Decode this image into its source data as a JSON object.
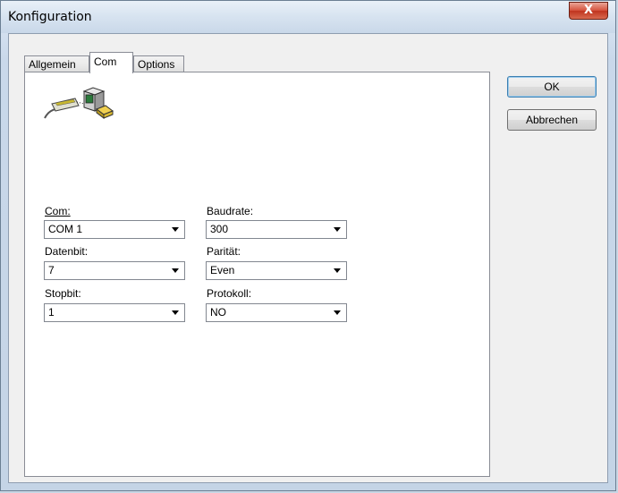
{
  "window": {
    "title": "Konfiguration",
    "close_glyph": "X"
  },
  "tabs": [
    {
      "label": "Allgemein",
      "active": false
    },
    {
      "label": "Com",
      "active": true
    },
    {
      "label": "Options",
      "active": false
    }
  ],
  "icon": "serial-port-computer-icon",
  "fields": {
    "com": {
      "label": "Com:",
      "value": "COM 1"
    },
    "baudrate": {
      "label": "Baudrate:",
      "value": "300"
    },
    "datenbit": {
      "label": "Datenbit:",
      "value": "7"
    },
    "paritaet": {
      "label": "Parität:",
      "value": "Even"
    },
    "stopbit": {
      "label": "Stopbit:",
      "value": "1"
    },
    "protokoll": {
      "label": "Protokoll:",
      "value": "NO"
    }
  },
  "buttons": {
    "ok": "OK",
    "cancel": "Abbrechen"
  },
  "colors": {
    "close_button": "#c0341f",
    "default_button_border": "#3c7fb1"
  }
}
